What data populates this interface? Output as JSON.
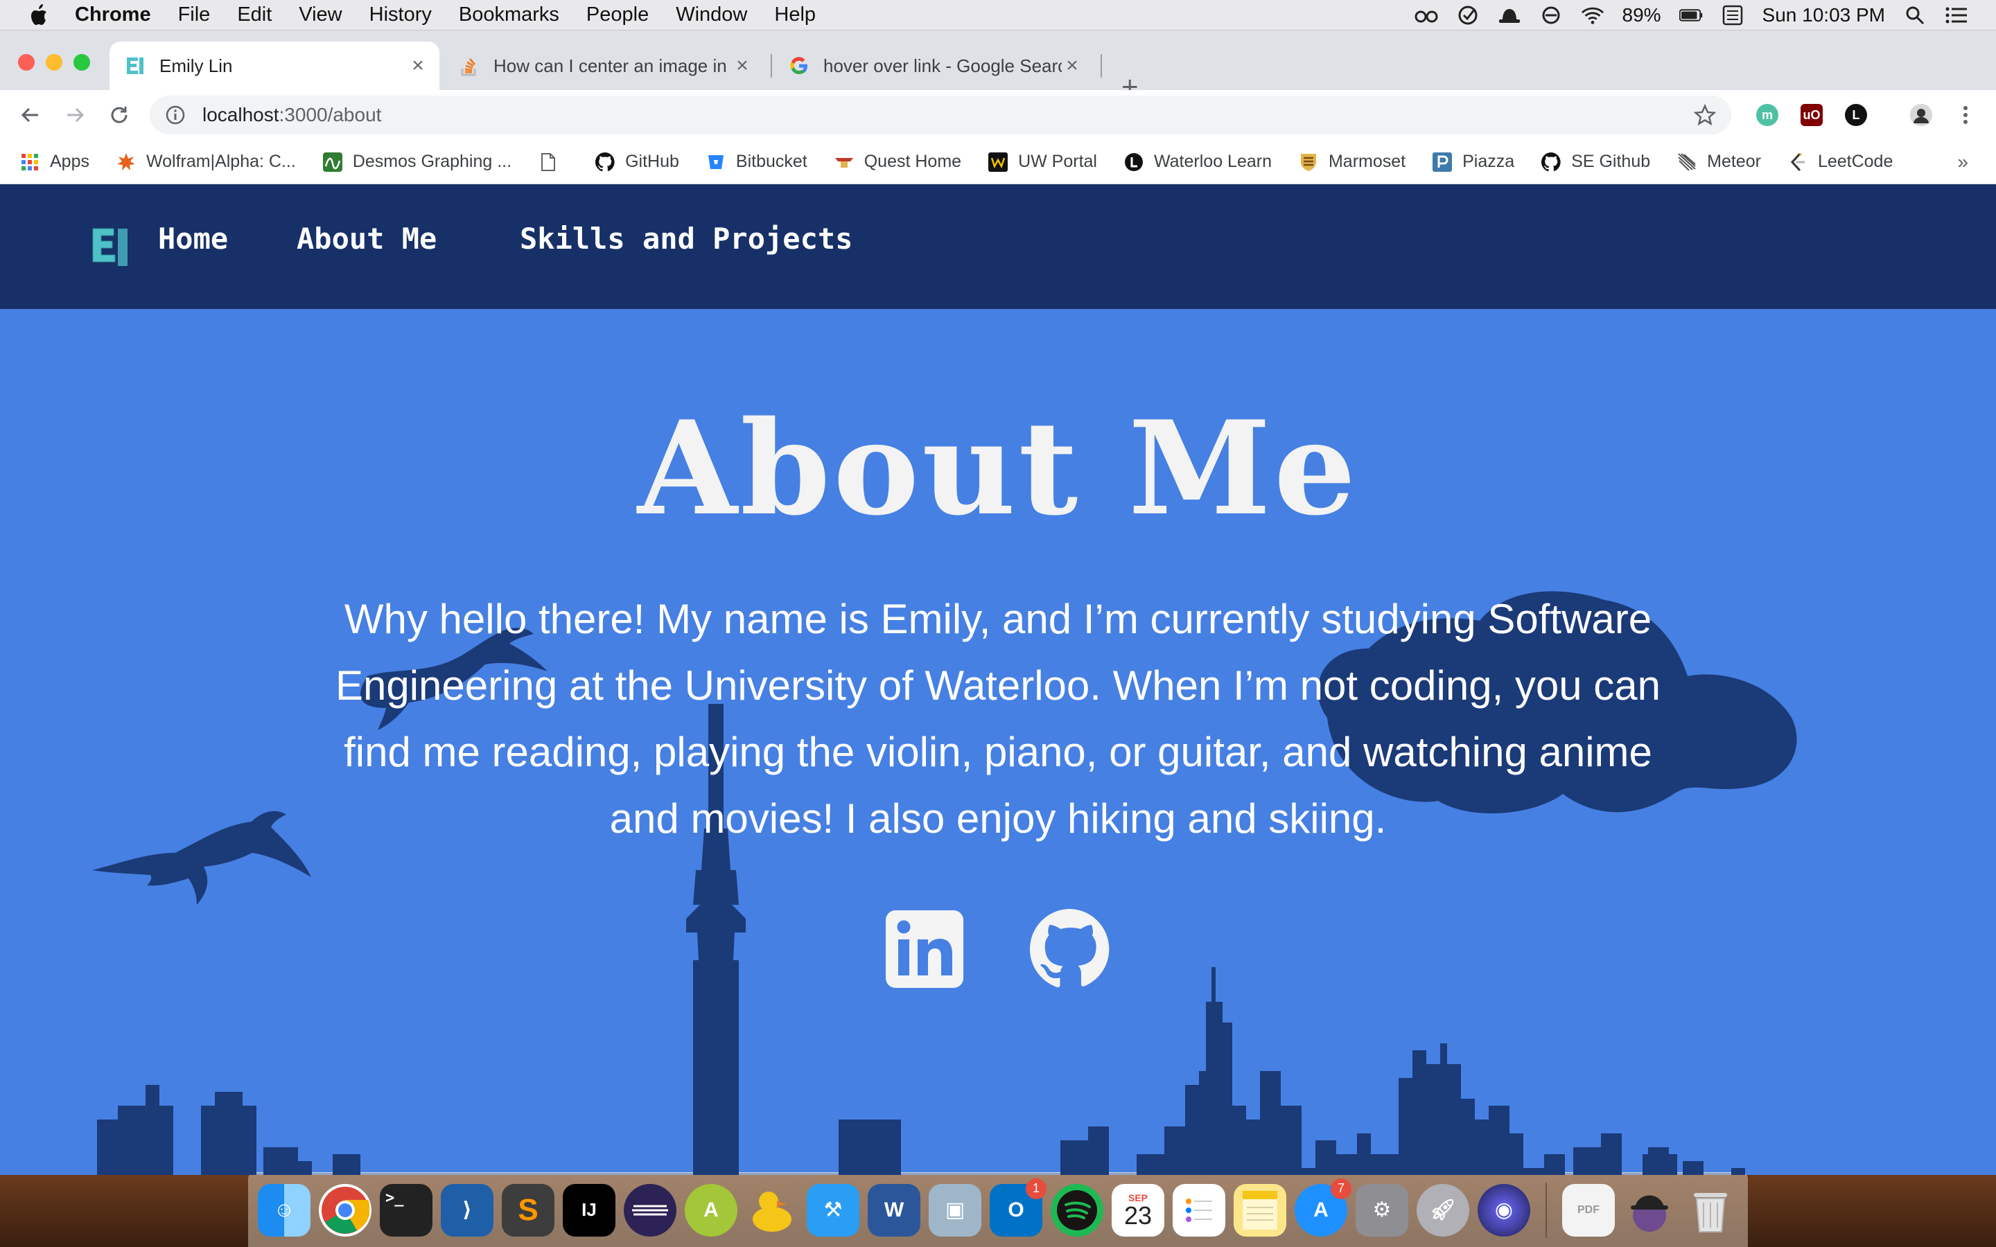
{
  "menubar": {
    "app": "Chrome",
    "items": [
      "File",
      "Edit",
      "View",
      "History",
      "Bookmarks",
      "People",
      "Window",
      "Help"
    ],
    "battery": "89%",
    "clock": "Sun 10:03 PM"
  },
  "tabs": [
    {
      "title": "Emily Lin",
      "active": true
    },
    {
      "title": "How can I center an image in B",
      "active": false
    },
    {
      "title": "hover over link - Google Search",
      "active": false
    }
  ],
  "omnibox": {
    "host": "localhost",
    "path": ":3000/about"
  },
  "bookmarks": [
    {
      "label": "Apps",
      "icon": "apps-grid-icon"
    },
    {
      "label": "Wolfram|Alpha: C...",
      "icon": "wolfram-icon"
    },
    {
      "label": "Desmos Graphing ...",
      "icon": "desmos-icon"
    },
    {
      "label": "",
      "icon": "page-icon"
    },
    {
      "label": "GitHub",
      "icon": "github-icon"
    },
    {
      "label": "Bitbucket",
      "icon": "bitbucket-icon"
    },
    {
      "label": "Quest Home",
      "icon": "quest-icon"
    },
    {
      "label": "UW Portal",
      "icon": "uw-portal-icon"
    },
    {
      "label": "Waterloo Learn",
      "icon": "learn-icon"
    },
    {
      "label": "Marmoset",
      "icon": "marmoset-icon"
    },
    {
      "label": "Piazza",
      "icon": "piazza-icon"
    },
    {
      "label": "SE Github",
      "icon": "github-icon"
    },
    {
      "label": "Meteor",
      "icon": "meteor-icon"
    },
    {
      "label": "LeetCode",
      "icon": "leetcode-icon"
    }
  ],
  "bookmarks_more": "»",
  "site": {
    "nav": {
      "home": "Home",
      "about": "About Me",
      "skills": "Skills and Projects"
    },
    "title": "About Me",
    "intro": "Why hello there! My name is Emily, and I’m currently studying Software Engineering at the University of Waterloo. When I’m not coding, you can find me reading, playing the violin, piano, or guitar, and watching anime and movies! I also enjoy hiking and skiing.",
    "social": [
      {
        "name": "linkedin-icon"
      },
      {
        "name": "github-icon"
      }
    ],
    "colors": {
      "nav_bg": "#173067",
      "page_bg": "#4680e3",
      "silhouette": "#1b3a78",
      "logo_accent": "#4ec1c9"
    }
  },
  "dock": {
    "calendar_month": "SEP",
    "calendar_day": "23",
    "outlook_badge": "1",
    "appstore_badge": "7"
  }
}
